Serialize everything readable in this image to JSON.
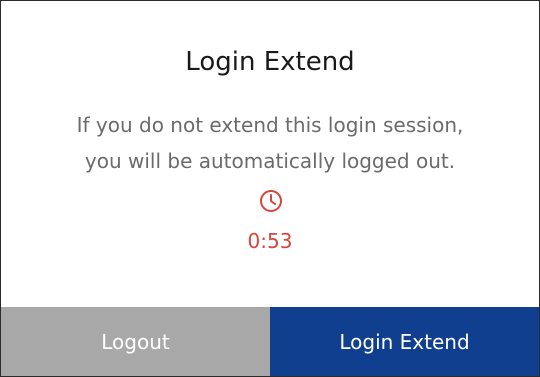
{
  "dialog": {
    "title": "Login Extend",
    "message_line1": "If you do not extend this login session,",
    "message_line2": "you will be automatically logged out.",
    "timer": {
      "icon": "clock-icon",
      "value": "0:53",
      "color": "#d6453a"
    }
  },
  "actions": {
    "logout_label": "Logout",
    "extend_label": "Login Extend",
    "logout_color": "#a8a8a8",
    "extend_color": "#113f8f"
  }
}
